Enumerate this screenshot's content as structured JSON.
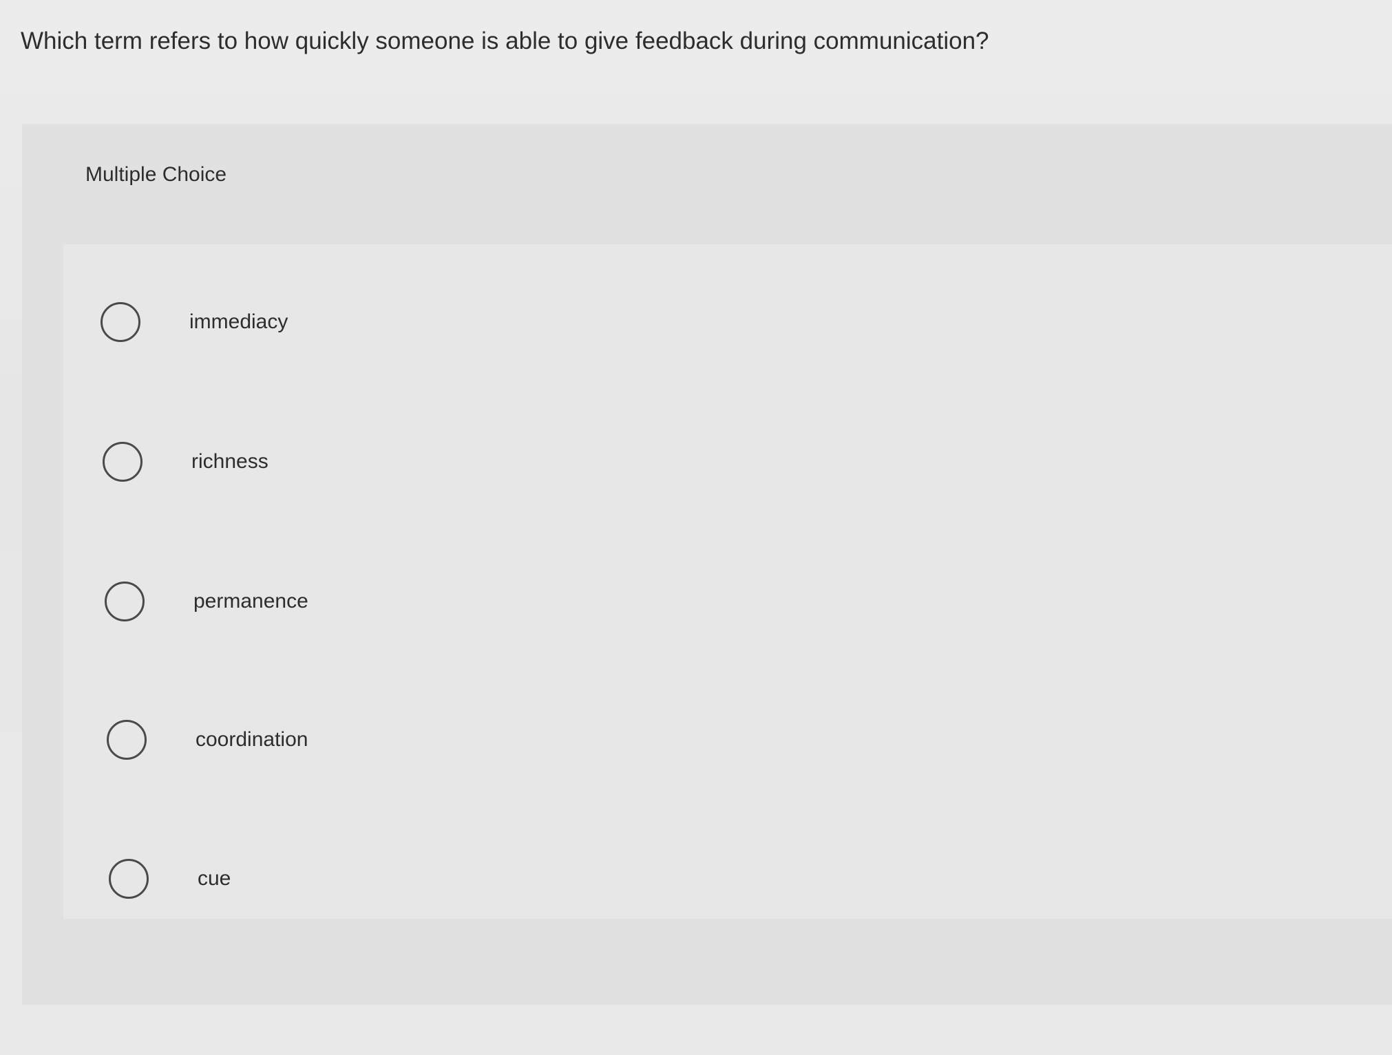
{
  "question": {
    "text": "Which term refers to how quickly someone is able to give feedback during communication?"
  },
  "panel": {
    "label": "Multiple Choice"
  },
  "options": [
    {
      "label": "immediacy",
      "selected": false
    },
    {
      "label": "richness",
      "selected": false
    },
    {
      "label": "permanence",
      "selected": false
    },
    {
      "label": "coordination",
      "selected": false
    },
    {
      "label": "cue",
      "selected": false
    }
  ]
}
